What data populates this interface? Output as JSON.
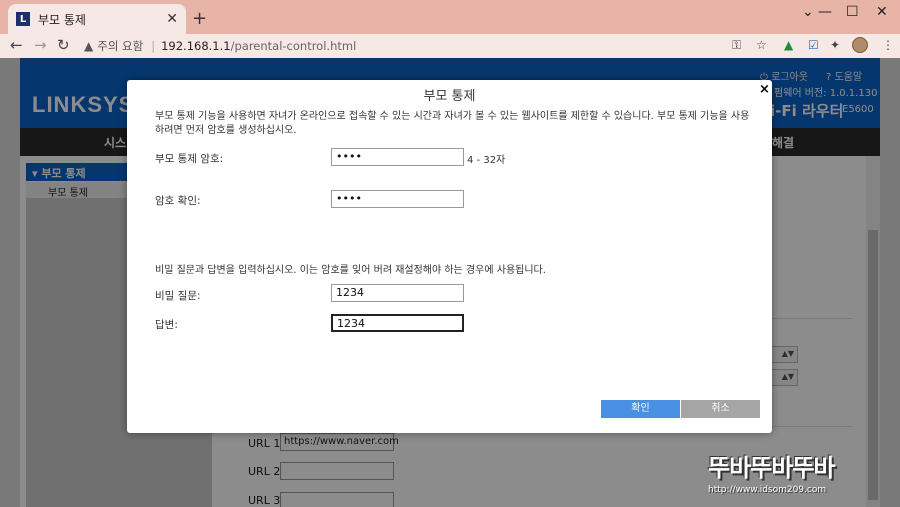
{
  "browser": {
    "tab_title": "부모 통제",
    "tab_favicon": "L",
    "security_label": "주의 요함",
    "url_host": "192.168.1.1",
    "url_path": "/parental-control.html"
  },
  "page": {
    "brand": "LINKSYS",
    "logout": "로그아웃",
    "help": "도움말",
    "firmware_label": "펌웨어 버전: 1.0.1.130",
    "router_name": "i-Fi 라우터",
    "model": "E5600",
    "menu_left": "시스",
    "menu_right": "해결",
    "sidebar_header": "부모 통제",
    "sidebar_item": "부모 통제",
    "url_rows": [
      {
        "label": "URL 1:",
        "value": "https://www.naver.com"
      },
      {
        "label": "URL 2:",
        "value": ""
      },
      {
        "label": "URL 3:",
        "value": ""
      }
    ]
  },
  "modal": {
    "title": "부모 통제",
    "close": "×",
    "intro": "부모 통제 기능을 사용하면 자녀가 온라인으로 접속할 수 있는 시간과 자녀가 볼 수 있는 웹사이트를 제한할 수 있습니다. 부모 통제 기능을 사용하려면 먼저 암호를 생성하십시오.",
    "password_label": "부모 통제 암호:",
    "password_value": "••••",
    "password_hint": "4 - 32자",
    "confirm_label": "암호 확인:",
    "confirm_value": "••••",
    "note": "비밀 질문과 답변을 입력하십시오. 이는 암호를 잊어 버려 재설정해야 하는 경우에 사용됩니다.",
    "question_label": "비밀 질문:",
    "question_value": "1234",
    "answer_label": "답변:",
    "answer_value": "1234",
    "ok_button": "확인",
    "cancel_button": "취소"
  },
  "watermark": {
    "top": "뚜바뚜바뚜바",
    "url": "http://www.idsom209.com"
  }
}
